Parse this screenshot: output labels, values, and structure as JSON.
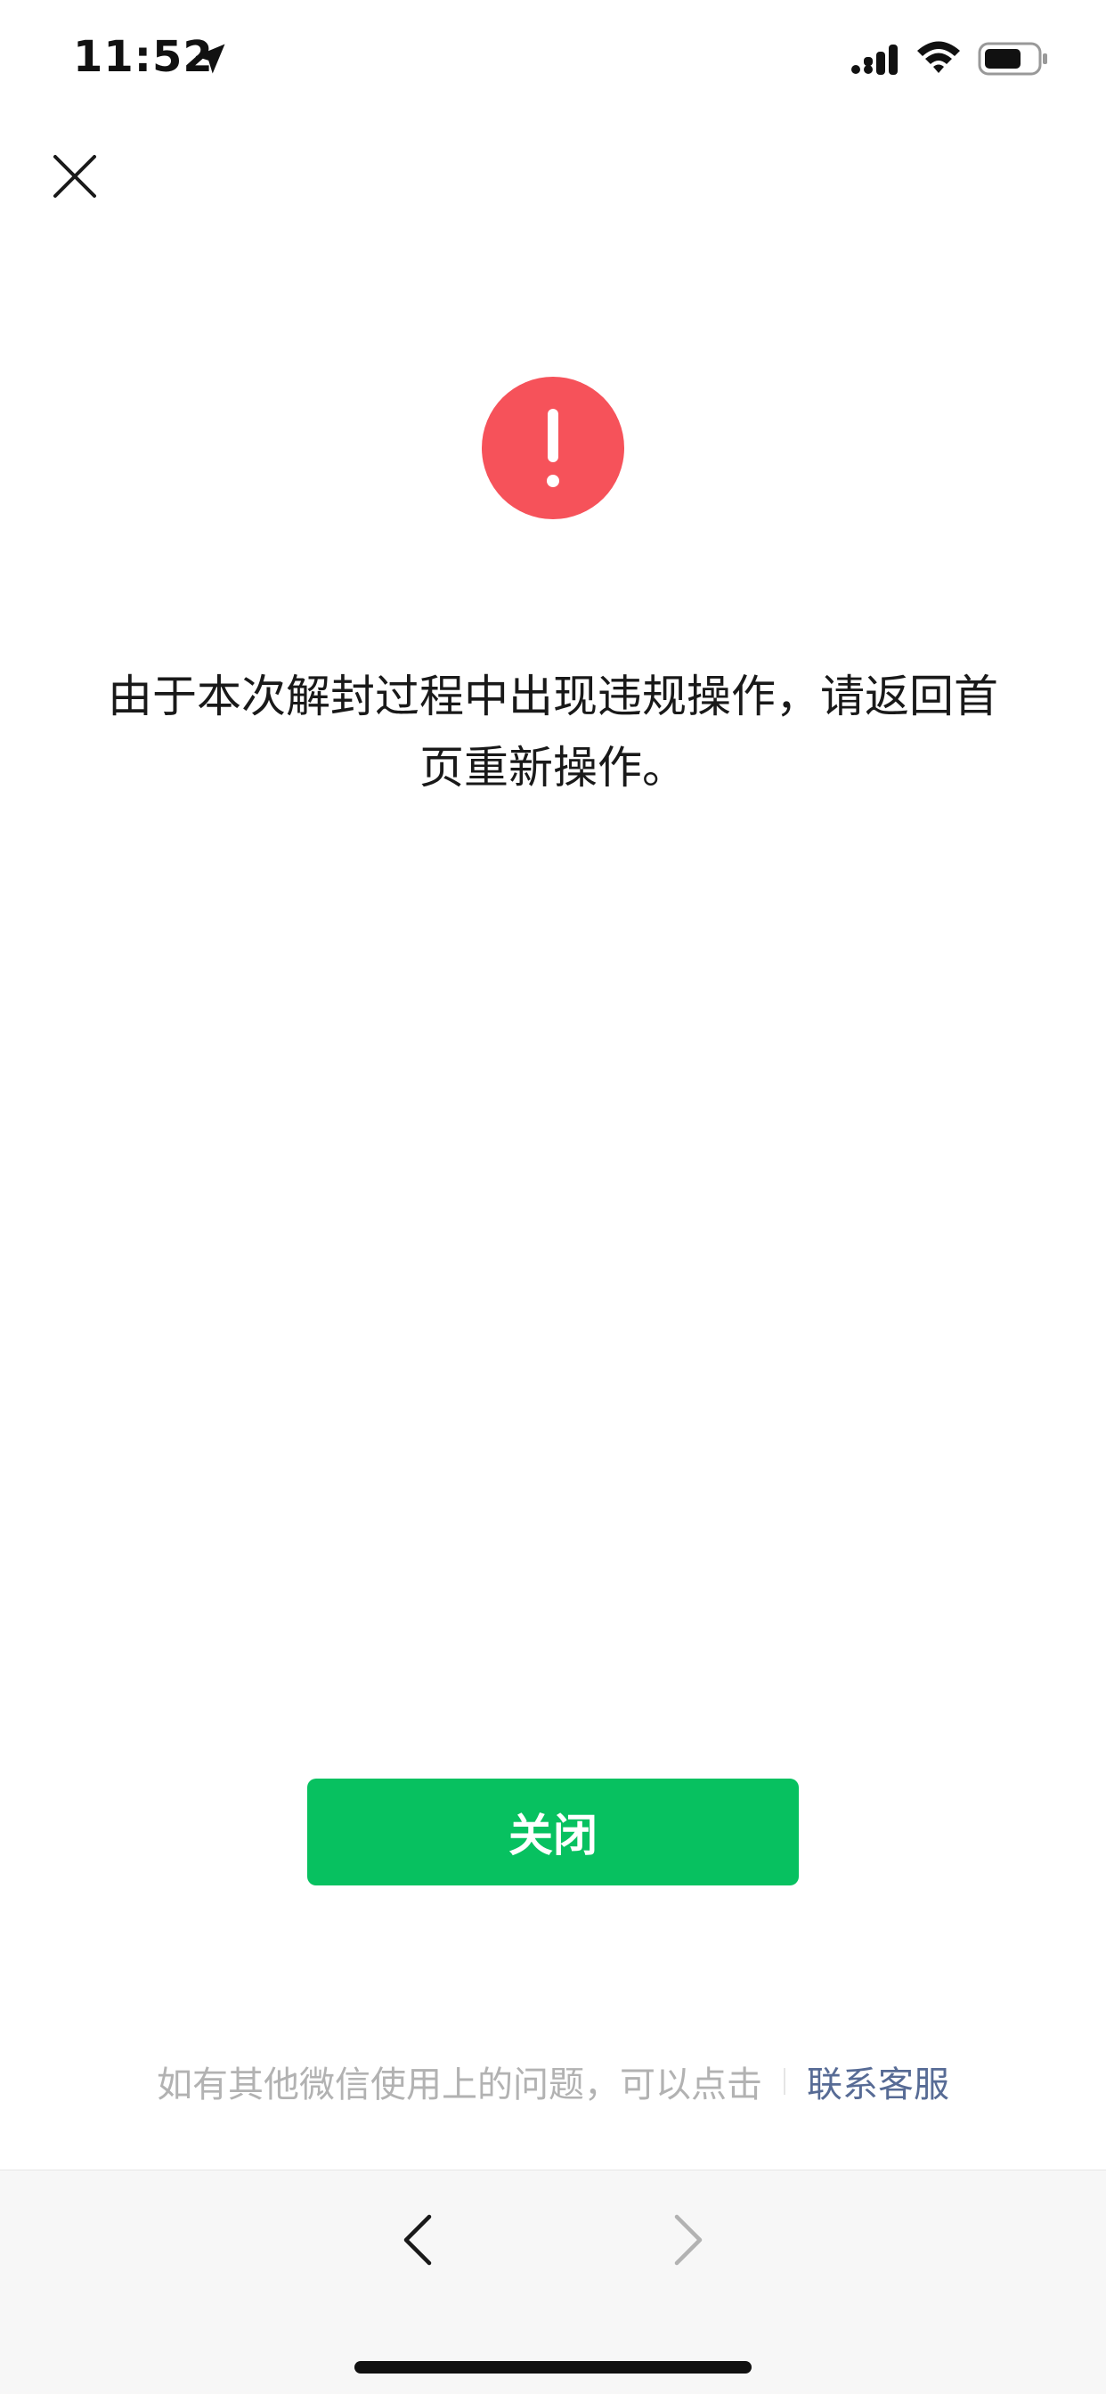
{
  "status_bar": {
    "time": "11:52",
    "icons": [
      "location-arrow-icon",
      "cellular-signal-icon",
      "wifi-icon",
      "battery-icon"
    ]
  },
  "header": {
    "close_icon": "close-icon"
  },
  "alert": {
    "icon": "error-exclamation-icon",
    "icon_color": "#f6525a",
    "message": "由于本次解封过程中出现违规操作，请返回首页重新操作。"
  },
  "actions": {
    "close_label": "关闭",
    "close_color": "#07c160"
  },
  "help": {
    "text": "如有其他微信使用上的问题，可以点击",
    "link_label": "联系客服",
    "link_color": "#576b95"
  },
  "toolbar": {
    "back_icon": "chevron-left-icon",
    "forward_icon": "chevron-right-icon"
  }
}
